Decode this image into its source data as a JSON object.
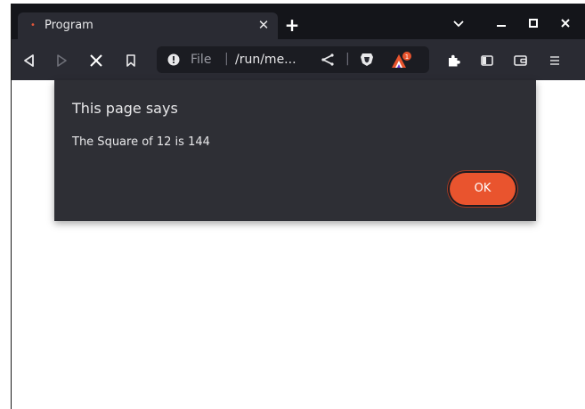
{
  "tab": {
    "favicon": "•",
    "title": "Program",
    "close_glyph": "✕"
  },
  "tabstrip": {
    "new_tab_glyph": "+",
    "tab_search_glyph": "⌄",
    "minimize_glyph": "–",
    "maximize_glyph": "□",
    "close_glyph": "✕"
  },
  "toolbar": {
    "back_icon": "back-icon",
    "forward_icon": "forward-icon",
    "stop_icon": "stop-icon",
    "bookmark_icon": "bookmark-icon",
    "url_scheme": "File",
    "url_separator": "|",
    "url_path": "/run/me...",
    "rewards_badge": "1"
  },
  "dialog": {
    "title": "This page says",
    "message": "The Square of 12 is 144",
    "ok_label": "OK"
  },
  "colors": {
    "tabstrip_bg": "#14151a",
    "toolbar_bg": "#2a2b33",
    "dialog_bg": "#2e2f35",
    "accent": "#e9542e"
  }
}
